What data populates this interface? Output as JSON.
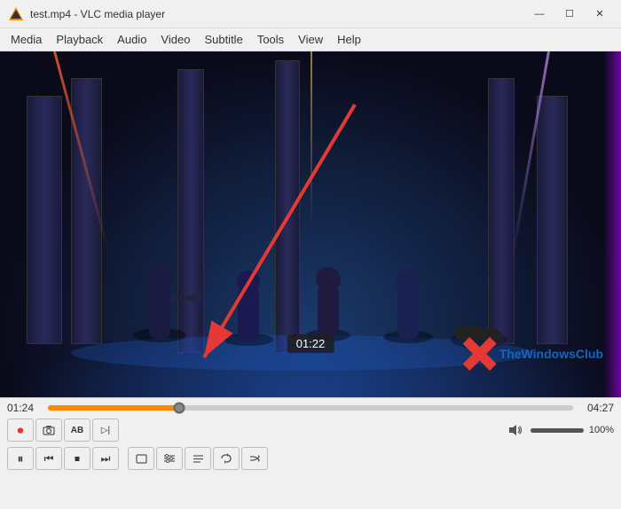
{
  "window": {
    "title": "test.mp4 - VLC media player"
  },
  "titlebar": {
    "minimize_label": "—",
    "maximize_label": "☐",
    "close_label": "✕"
  },
  "menu": {
    "items": [
      {
        "label": "Media"
      },
      {
        "label": "Playback"
      },
      {
        "label": "Audio"
      },
      {
        "label": "Video"
      },
      {
        "label": "Subtitle"
      },
      {
        "label": "Tools"
      },
      {
        "label": "View"
      },
      {
        "label": "Help"
      }
    ]
  },
  "player": {
    "time_current": "01:24",
    "time_total": "04:27",
    "tooltip_time": "01:22",
    "volume": "100%",
    "progress_percent": 25
  },
  "controls": {
    "row1": [
      {
        "name": "record",
        "icon": "⏺",
        "color": "red"
      },
      {
        "name": "snapshot",
        "icon": "📷"
      },
      {
        "name": "ab-loop",
        "icon": "🔤"
      },
      {
        "name": "frame-next",
        "icon": "▷|"
      }
    ],
    "row2": [
      {
        "name": "play-pause",
        "icon": "⏸"
      },
      {
        "name": "prev",
        "icon": "⏮"
      },
      {
        "name": "stop",
        "icon": "⏹"
      },
      {
        "name": "next",
        "icon": "⏭"
      },
      {
        "name": "fullscreen",
        "icon": "⛶"
      },
      {
        "name": "ext-settings",
        "icon": "⚙"
      },
      {
        "name": "playlist",
        "icon": "☰"
      },
      {
        "name": "loop",
        "icon": "🔁"
      },
      {
        "name": "random",
        "icon": "🔀"
      }
    ]
  },
  "watermark": {
    "text": "TheWindowsClub"
  }
}
